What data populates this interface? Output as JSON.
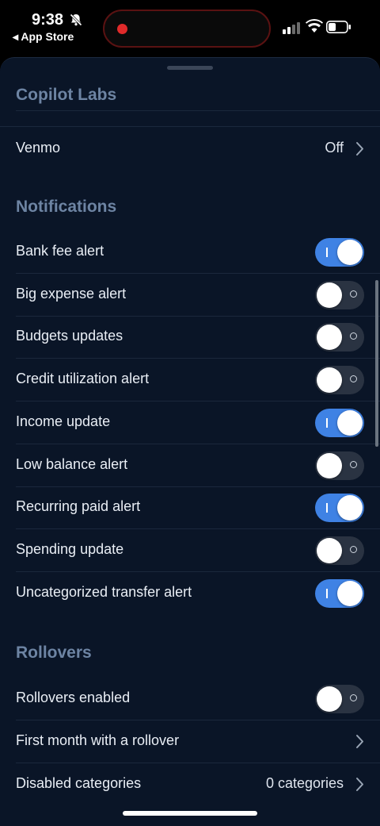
{
  "status_bar": {
    "time": "9:38",
    "back_label": "◂ App Store"
  },
  "sections": {
    "copilot_labs": {
      "title": "Copilot Labs"
    },
    "notifications": {
      "title": "Notifications"
    },
    "rollovers": {
      "title": "Rollovers"
    }
  },
  "venmo": {
    "label": "Venmo",
    "value": "Off"
  },
  "notifications": [
    {
      "label": "Bank fee alert",
      "on": true
    },
    {
      "label": "Big expense alert",
      "on": false
    },
    {
      "label": "Budgets updates",
      "on": false
    },
    {
      "label": "Credit utilization alert",
      "on": false
    },
    {
      "label": "Income update",
      "on": true
    },
    {
      "label": "Low balance alert",
      "on": false
    },
    {
      "label": "Recurring paid alert",
      "on": true
    },
    {
      "label": "Spending update",
      "on": false
    },
    {
      "label": "Uncategorized transfer alert",
      "on": true
    }
  ],
  "rollovers": {
    "enabled": {
      "label": "Rollovers enabled",
      "on": false
    },
    "first_month": {
      "label": "First month with a rollover"
    },
    "disabled_categories": {
      "label": "Disabled categories",
      "value": "0 categories"
    }
  },
  "colors": {
    "sheet_bg": "#0a1527",
    "section_title": "#6d84a3",
    "toggle_on": "#3f82e4",
    "toggle_off": "#2a3342"
  }
}
